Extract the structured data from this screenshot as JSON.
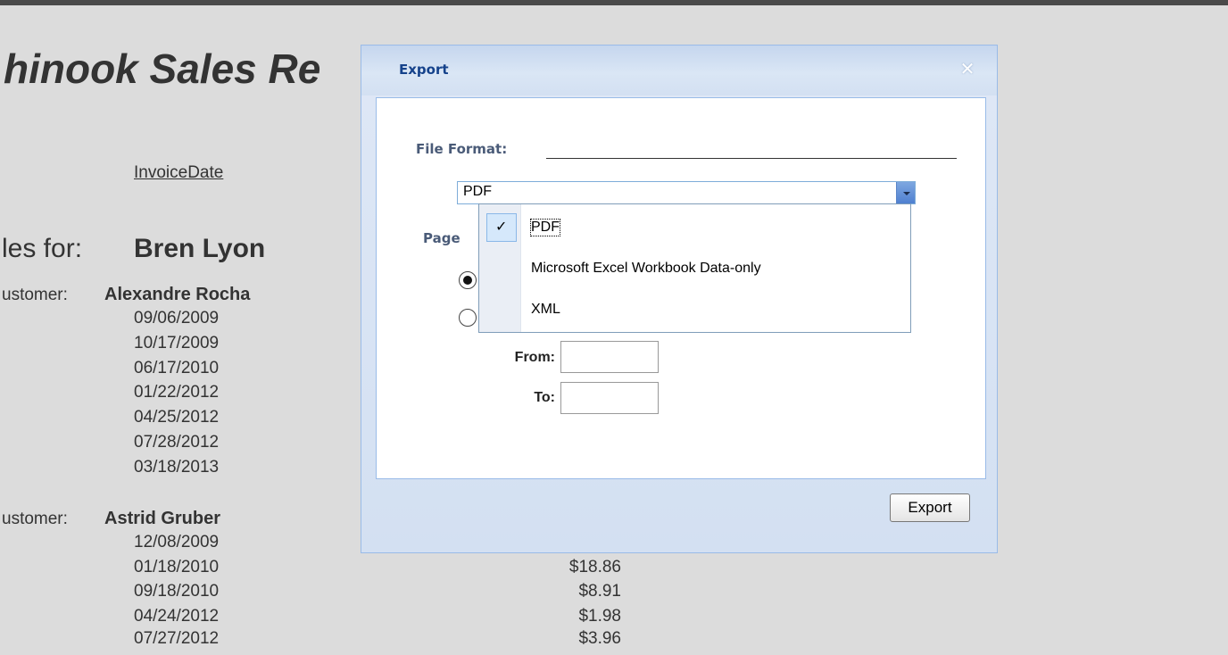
{
  "report": {
    "title": "hinook Sales Re",
    "column_header": "InvoiceDate",
    "sales_for_label": "les for:",
    "salesperson": "Bren Lyon",
    "customers": [
      {
        "label": "ustomer:",
        "name": "Alexandre Rocha",
        "dates": [
          "09/06/2009",
          "10/17/2009",
          "06/17/2010",
          "01/22/2012",
          "04/25/2012",
          "07/28/2012",
          "03/18/2013"
        ]
      },
      {
        "label": "ustomer:",
        "name": "Astrid Gruber",
        "dates": [
          "12/08/2009",
          "01/18/2010",
          "09/18/2010",
          "04/24/2012",
          "07/27/2012"
        ],
        "amounts": [
          "$18.86",
          "$8.91",
          "$1.98",
          "$3.96"
        ]
      }
    ]
  },
  "dialog": {
    "title": "Export",
    "close_icon": "close-x-icon",
    "file_format_label": "File Format:",
    "selected_format": "PDF",
    "page_label": "Page",
    "from_label": "From:",
    "to_label": "To:",
    "from_value": "",
    "to_value": "",
    "export_label": "Export"
  },
  "dropdown": {
    "items": [
      "PDF",
      "Microsoft Excel Workbook Data-only",
      "XML"
    ],
    "checked_icon": "checkmark-icon",
    "check_glyph": "✓"
  },
  "colors": {
    "header_text": "#15428b",
    "border": "#99bbe8",
    "label_text": "#4a5b78",
    "background": "#dcdcdc"
  }
}
